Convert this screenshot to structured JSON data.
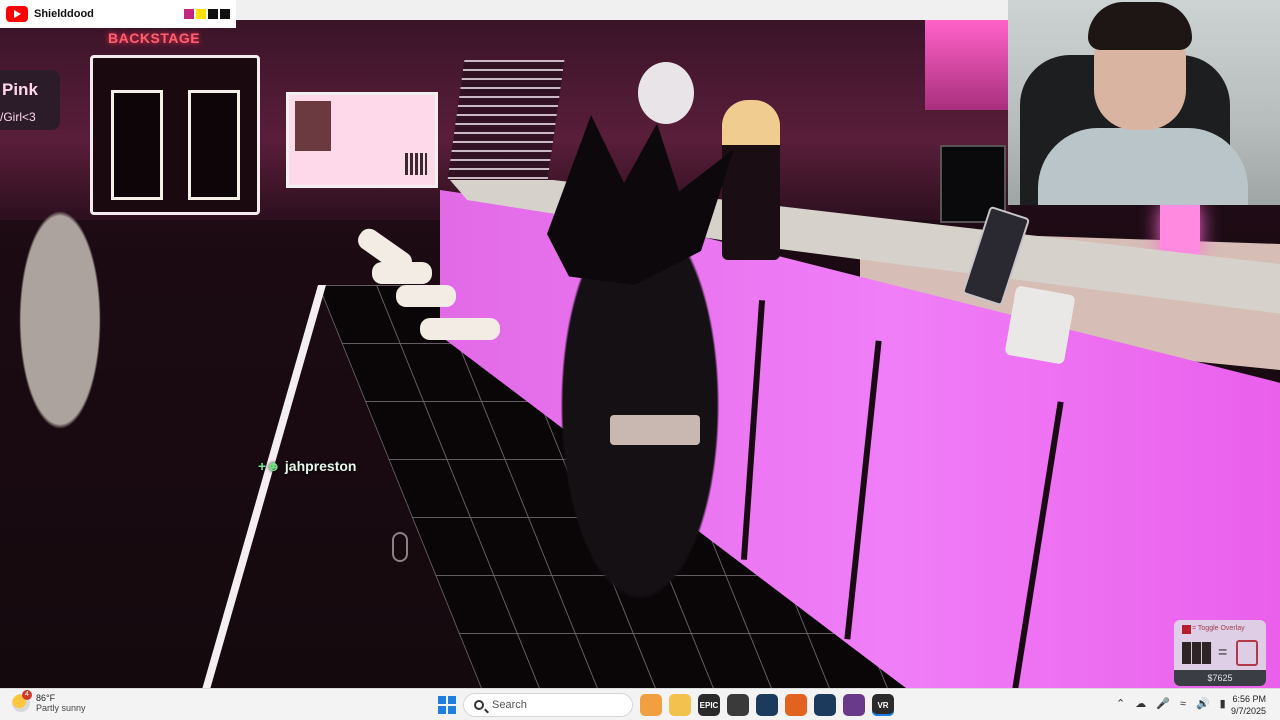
{
  "stream_header": {
    "channel_name": "Shielddood",
    "swatch_colors": [
      "#c2267e",
      "#ffe200",
      "#111111",
      "#111111"
    ]
  },
  "scene": {
    "backstage_sign": "BACKSTAGE",
    "side_sign_line1": "Pink",
    "side_sign_line2": "/Girl<3",
    "player_nametag": "jahpreston",
    "accent_pink": "#f07ef8"
  },
  "overlay_widget": {
    "hint": "= Toggle Overlay",
    "money": "$7625"
  },
  "taskbar": {
    "weather": {
      "temp": "86°F",
      "condition": "Partly sunny",
      "badge": "4"
    },
    "search_placeholder": "Search",
    "apps": [
      {
        "name": "photos",
        "label": "",
        "color": "#f0a040"
      },
      {
        "name": "file-explorer",
        "label": "",
        "color": "#f2c14e"
      },
      {
        "name": "epic-games",
        "label": "EPIC",
        "color": "#2a2a2a"
      },
      {
        "name": "obs",
        "label": "",
        "color": "#3a3a3a"
      },
      {
        "name": "steam",
        "label": "",
        "color": "#1b3a5c"
      },
      {
        "name": "firefox",
        "label": "",
        "color": "#e2621f"
      },
      {
        "name": "steam-2",
        "label": "",
        "color": "#1b3a5c"
      },
      {
        "name": "vrchat-app",
        "label": "",
        "color": "#6a3a8a"
      },
      {
        "name": "steamvr",
        "label": "VR",
        "color": "#2b2b2b"
      }
    ],
    "time": "6:56 PM",
    "date": "9/7/2025"
  }
}
